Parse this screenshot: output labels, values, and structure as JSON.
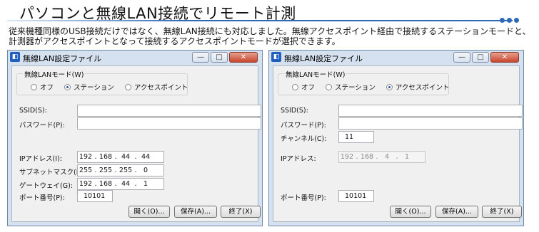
{
  "header": {
    "title": "パソコンと無線LAN接続でリモート計測",
    "description": "従来機種同様のUSB接続だけではなく、無線LAN接続にも対応しました。無線アクセスポイント経由で接続するステーションモードと、計測器がアクセスポイントとなって接続するアクセスポイントモードが選択できます。",
    "accent_color": "#2d69b7"
  },
  "windows": [
    {
      "title": "無線LAN設定ファイル",
      "mode_group_label": "無線LANモード(W)",
      "modes": [
        {
          "label": "オフ",
          "selected": false
        },
        {
          "label": "ステーション",
          "selected": true
        },
        {
          "label": "アクセスポイント",
          "selected": false
        }
      ],
      "ssid_label": "SSID(S):",
      "ssid_value": "",
      "password_label": "パスワード(P):",
      "password_value": "",
      "ip_label": "IPアドレス(I):",
      "ip": [
        "192",
        "168",
        "44",
        "44"
      ],
      "subnet_label": "サブネットマスク(M):",
      "subnet": [
        "255",
        "255",
        "255",
        "0"
      ],
      "gateway_label": "ゲートウェイ(G):",
      "gateway": [
        "192",
        "168",
        "44",
        "1"
      ],
      "port_label": "ポート番号(P):",
      "port_value": "10101",
      "buttons": {
        "open": "開く(O)...",
        "save": "保存(A)...",
        "exit": "終了(X)"
      }
    },
    {
      "title": "無線LAN設定ファイル",
      "mode_group_label": "無線LANモード(W)",
      "modes": [
        {
          "label": "オフ",
          "selected": false
        },
        {
          "label": "ステーション",
          "selected": false
        },
        {
          "label": "アクセスポイント",
          "selected": true
        }
      ],
      "ssid_label": "SSID(S):",
      "ssid_value": "",
      "password_label": "パスワード(P):",
      "password_value": "",
      "channel_label": "チャンネル(C):",
      "channel_value": "11",
      "ip_label": "IPアドレス:",
      "ip": [
        "192",
        "168",
        "4",
        "1"
      ],
      "port_label": "ポート番号(P):",
      "port_value": "10101",
      "buttons": {
        "open": "開く(O)...",
        "save": "保存(A)...",
        "exit": "終了(X)"
      }
    }
  ]
}
